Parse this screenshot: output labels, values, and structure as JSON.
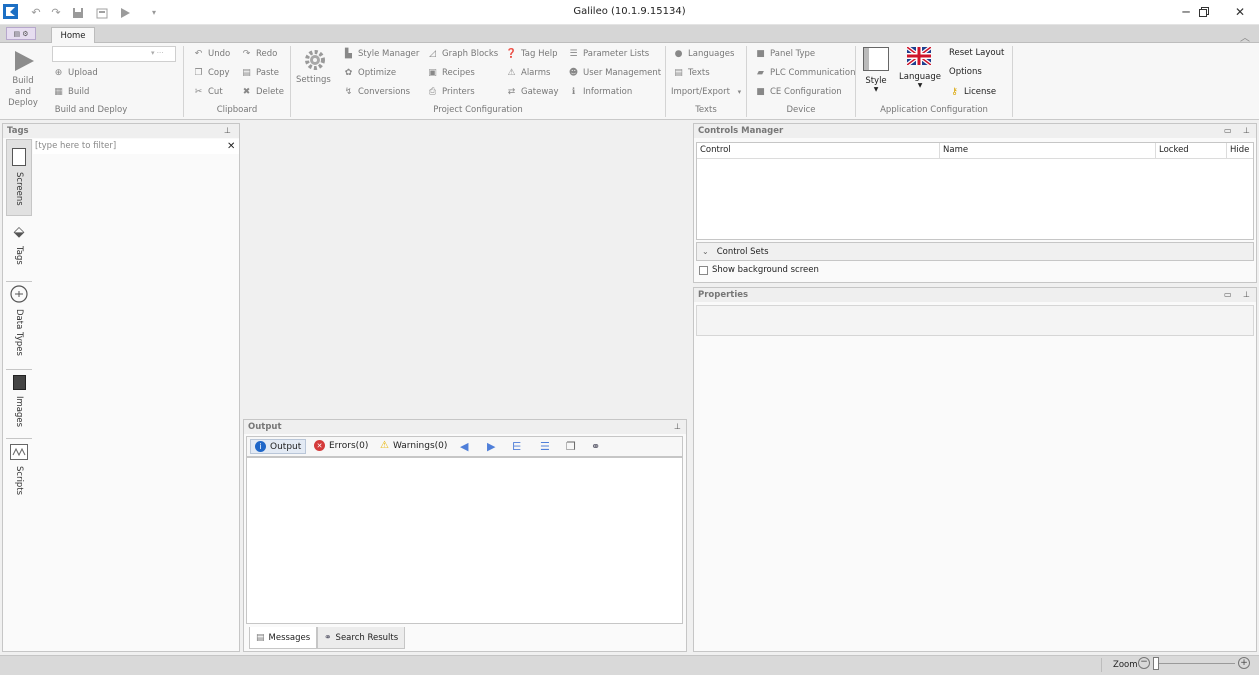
{
  "window": {
    "title": "Galileo (10.1.9.15134)"
  },
  "tabs": {
    "home": "Home"
  },
  "ribbon": {
    "build_and_deploy": {
      "big_button": "Build and Deploy",
      "upload": "Upload",
      "build": "Build",
      "group_label": "Build and Deploy"
    },
    "clipboard": {
      "undo": "Undo",
      "redo": "Redo",
      "copy": "Copy",
      "paste": "Paste",
      "cut": "Cut",
      "delete": "Delete",
      "group_label": "Clipboard"
    },
    "project_configuration": {
      "settings": "Settings",
      "style_manager": "Style Manager",
      "optimize": "Optimize",
      "conversions": "Conversions",
      "graph_blocks": "Graph Blocks",
      "recipes": "Recipes",
      "printers": "Printers",
      "tag_help": "Tag Help",
      "alarms": "Alarms",
      "gateway": "Gateway",
      "parameter_lists": "Parameter Lists",
      "user_management": "User Management",
      "information": "Information",
      "group_label": "Project Configuration"
    },
    "texts": {
      "languages": "Languages",
      "texts": "Texts",
      "import_export": "Import/Export",
      "group_label": "Texts"
    },
    "device": {
      "panel_type": "Panel Type",
      "plc_communication": "PLC Communication",
      "ce_configuration": "CE Configuration",
      "group_label": "Device"
    },
    "application_configuration": {
      "style": "Style",
      "language": "Language",
      "reset_layout": "Reset Layout",
      "options": "Options",
      "license": "License",
      "group_label": "Application Configuration"
    }
  },
  "tags_panel": {
    "title": "Tags",
    "filter_placeholder": "[type here to filter]",
    "side_tabs": [
      "Screens",
      "Tags",
      "Data Types",
      "Images",
      "Scripts"
    ]
  },
  "output_panel": {
    "title": "Output",
    "output": "Output",
    "errors": "Errors(0)",
    "warnings": "Warnings(0)",
    "bottom_tabs": {
      "messages": "Messages",
      "search_results": "Search Results"
    }
  },
  "controls_manager": {
    "title": "Controls Manager",
    "columns": [
      "Control",
      "Name",
      "Locked",
      "Hide"
    ],
    "control_sets": "Control Sets",
    "show_background": "Show background screen"
  },
  "properties_panel": {
    "title": "Properties"
  },
  "status_bar": {
    "zoom_label": "Zoom"
  }
}
